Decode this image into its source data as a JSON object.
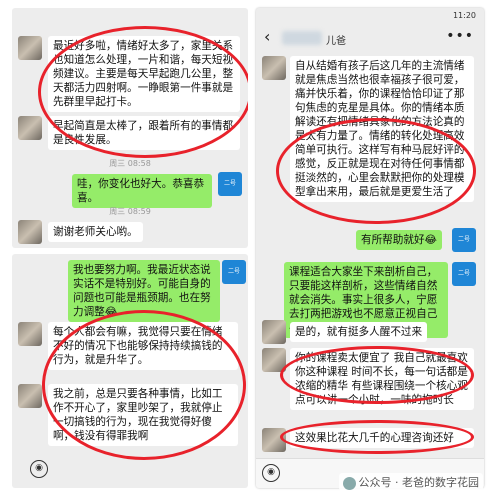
{
  "panel1": {
    "msg1": "最近好多啦，情绪好太多了，家里关系也知道怎么处理，一片和谐，每天短视频建议。主要是每天早起跑几公里，整天都活力四射啊。一睁眼第一件事就是先群里早起打卡。",
    "msg2": "早起简直是太棒了，跟着所有的事情都是良性发展。",
    "time1": "周三 08:58",
    "reply1": "哇，你变化也好大。恭喜恭喜。",
    "time2": "周三 08:59",
    "msg3": "谢谢老师关心哟。"
  },
  "panel2": {
    "reply1": "我也要努力啊。我最近状态说实话不是特别好。可能自身的问题也可能是瓶颈期。也在努力调整😂",
    "msg1": "每个人都会有嘛，我觉得只要在情绪不好的情况下也能够保持持续搞钱的行为，就是升华了。",
    "msg2": "我之前，总是只要各种事情，比如工作不开心了，家里吵架了，我就停止一切搞钱的行为，现在我觉得好傻啊，钱没有得罪我啊"
  },
  "panel3": {
    "status_time": "11:20",
    "title_suffix": "儿爸",
    "msg1": "自从结婚有孩子后这几年的主流情绪就是焦虑当然也很幸福孩子很可爱，痛并快乐着，你的课程恰恰印证了那句焦虑的克星是具体。你的情绪本质解读还有把情绪具象化的方法论真的是太有力量了。情绪的转化处理高效简单可执行。这样写有种马屁好评的感觉，反正就是现在对待任何事情都挺淡然的，心里会默默把你的处理模型拿出来用，最后就是更爱生活了",
    "reply1": "有所帮助就好😂",
    "reply2": "课程适合大家坐下来剖析自己，只要能这样剖析，这些情绪自然就会消失。事实上很多人，宁愿去打两把游戏也不愿意正视自己😂",
    "msg2": "是的，就有挺多人醒不过来",
    "msg3": "你的课程卖太便宜了 我自己就最喜欢你这种课程 时间不长，每一句话都是浓缩的精华 有些课程围绕一个核心观点可以讲一个小时，一味的拖时长",
    "msg4": "这效果比花大几千的心理咨询还好",
    "my_avatar_label": "二号"
  },
  "watermark": "公众号 · 老爸的数字花园"
}
